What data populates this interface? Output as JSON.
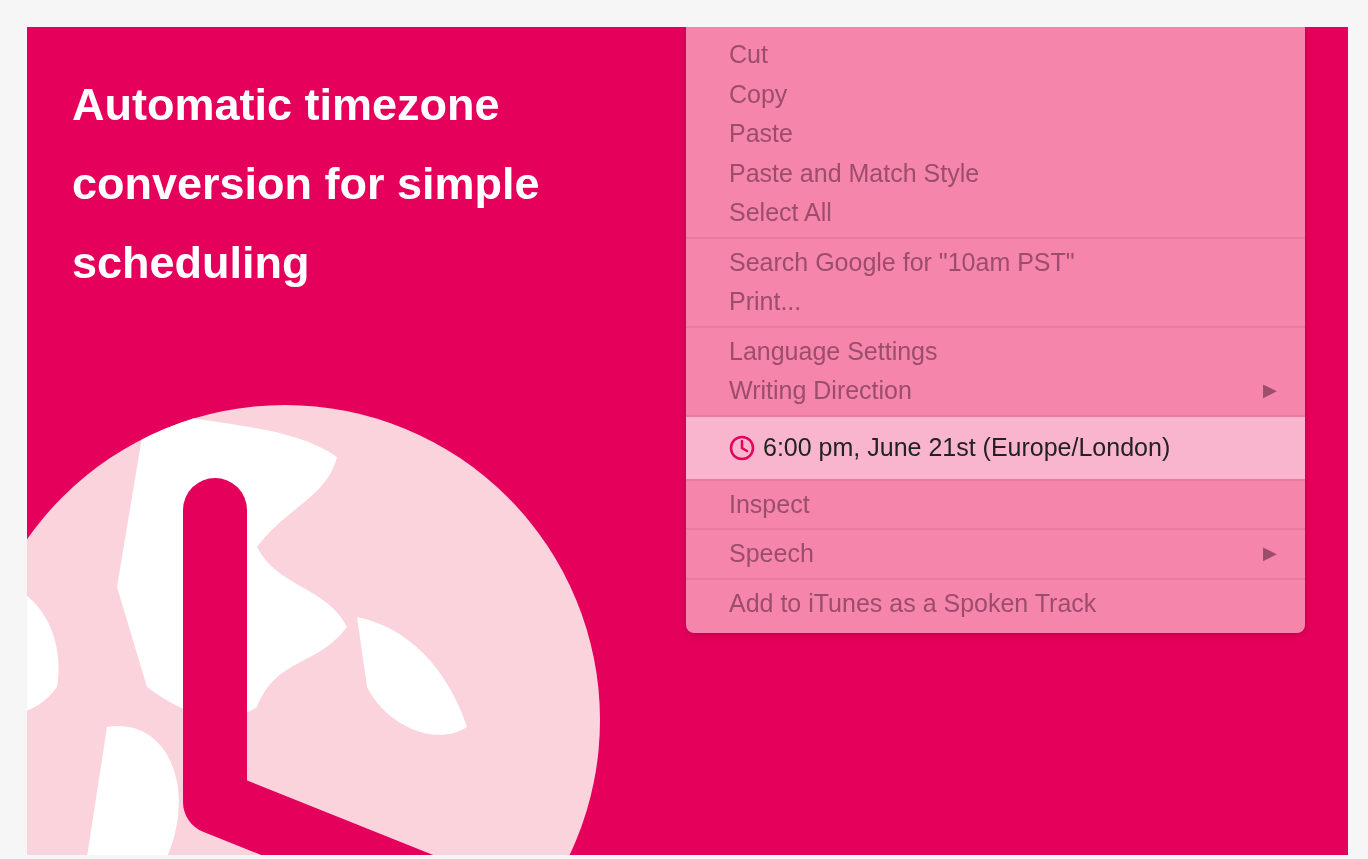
{
  "headline": "Automatic timezone conversion for simple scheduling",
  "menu": {
    "groups": [
      {
        "items": [
          {
            "label": "Cut",
            "kind": "text",
            "selected": false
          },
          {
            "label": "Copy",
            "kind": "text",
            "selected": false
          },
          {
            "label": "Paste",
            "kind": "text",
            "selected": false
          },
          {
            "label": "Paste and Match Style",
            "kind": "text",
            "selected": false
          },
          {
            "label": "Select All",
            "kind": "text",
            "selected": false
          }
        ]
      },
      {
        "items": [
          {
            "label": "Search Google for \"10am PST\"",
            "kind": "text",
            "selected": false
          },
          {
            "label": "Print...",
            "kind": "text",
            "selected": false
          }
        ]
      },
      {
        "items": [
          {
            "label": "Language Settings",
            "kind": "text",
            "selected": false
          },
          {
            "label": "Writing Direction",
            "kind": "submenu",
            "arrow": "▶",
            "selected": false
          }
        ]
      },
      {
        "items": [
          {
            "label": "6:00 pm, June 21st (Europe/London)",
            "kind": "time",
            "selected": true
          }
        ]
      },
      {
        "items": [
          {
            "label": "Inspect",
            "kind": "text",
            "selected": false
          }
        ]
      },
      {
        "items": [
          {
            "label": "Speech",
            "kind": "submenu",
            "arrow": "▶",
            "selected": false
          }
        ]
      },
      {
        "items": [
          {
            "label": "Add to iTunes as a Spoken Track",
            "kind": "text",
            "selected": false
          }
        ]
      }
    ]
  }
}
